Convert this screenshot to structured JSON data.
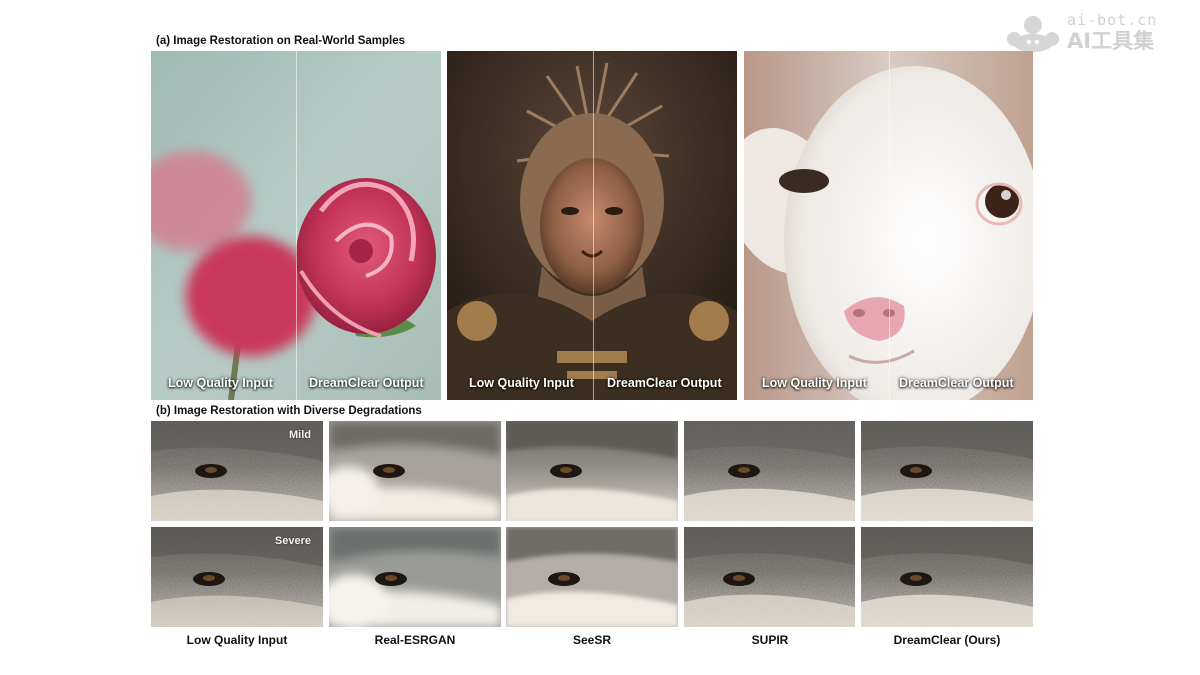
{
  "watermark": {
    "domain": "ai-bot.cn",
    "name": "AI工具集"
  },
  "section_a": {
    "title": "(a) Image Restoration on Real-World Samples",
    "panels": [
      {
        "subject": "rose",
        "left_caption": "Low Quality Input",
        "right_caption": "DreamClear Output"
      },
      {
        "subject": "monkey-king",
        "left_caption": "Low Quality Input",
        "right_caption": "DreamClear Output"
      },
      {
        "subject": "lamb",
        "left_caption": "Low Quality Input",
        "right_caption": "DreamClear Output"
      }
    ]
  },
  "section_b": {
    "title": "(b) Image Restoration with Diverse Degradations",
    "row_tags": [
      "Mild",
      "Severe"
    ],
    "columns": [
      "Low Quality Input",
      "Real-ESRGAN",
      "SeeSR",
      "SUPIR",
      "DreamClear (Ours)"
    ]
  },
  "colors": {
    "caption_text": "#ffffff",
    "title_text": "#111111",
    "watermark": "#c9c9c9"
  }
}
